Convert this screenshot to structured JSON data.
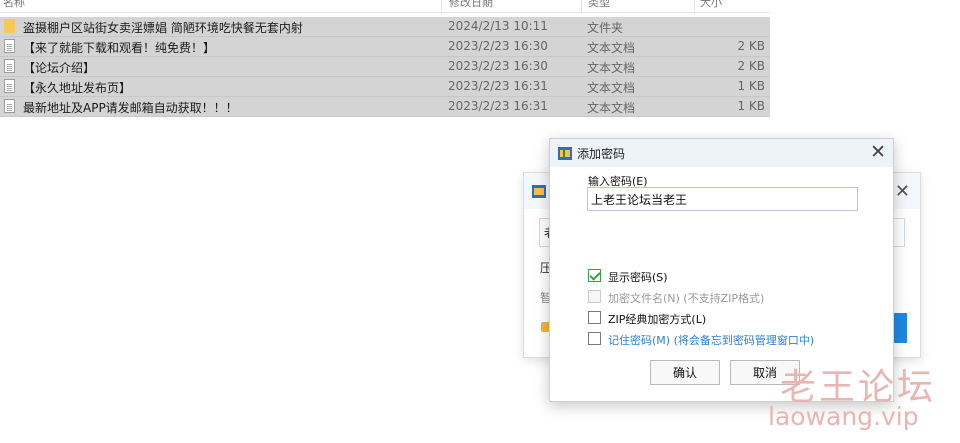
{
  "file_list": {
    "header": {
      "name": "名称",
      "date": "修改日期",
      "type": "类型",
      "size": "大小"
    },
    "rows": [
      {
        "name": "盗摄棚户区站街女卖淫嫖娼 简陋环境吃快餐无套内射",
        "date": "2024/2/13 10:11",
        "type": "文件夹",
        "size": "",
        "icon": "folder-icon"
      },
      {
        "name": "【来了就能下载和观看！纯免费！】",
        "date": "2023/2/23 16:30",
        "type": "文本文档",
        "size": "2 KB",
        "icon": "text-file-icon"
      },
      {
        "name": "【论坛介绍】",
        "date": "2023/2/23 16:30",
        "type": "文本文档",
        "size": "2 KB",
        "icon": "text-file-icon"
      },
      {
        "name": "【永久地址发布页】",
        "date": "2023/2/23 16:31",
        "type": "文本文档",
        "size": "1 KB",
        "icon": "text-file-icon"
      },
      {
        "name": "最新地址及APP请发邮箱自动获取！！！",
        "date": "2023/2/23 16:31",
        "type": "文本文档",
        "size": "1 KB",
        "icon": "text-file-icon"
      }
    ]
  },
  "background_dialog": {
    "input_prefix": "老",
    "label_1": "压",
    "label_2": "智"
  },
  "dialog": {
    "title": "添加密码",
    "close_glyph": "✕",
    "password_label": "输入密码(E)",
    "password_value": "上老王论坛当老王",
    "options": [
      {
        "label": "显示密码(S)",
        "checked": true,
        "disabled": false,
        "color": "#111111"
      },
      {
        "label": "加密文件名(N) (不支持ZIP格式)",
        "checked": false,
        "disabled": true,
        "color": "#9a9a9a"
      },
      {
        "label": "ZIP经典加密方式(L)",
        "checked": false,
        "disabled": false,
        "color": "#111111"
      },
      {
        "label": "记住密码(M) (将会备忘到密码管理窗口中)",
        "checked": false,
        "disabled": false,
        "color": "#2d7fd0"
      }
    ],
    "ok_label": "确认",
    "cancel_label": "取消"
  },
  "watermark": {
    "line1": "老王论坛",
    "line2": "laowang.vip"
  }
}
